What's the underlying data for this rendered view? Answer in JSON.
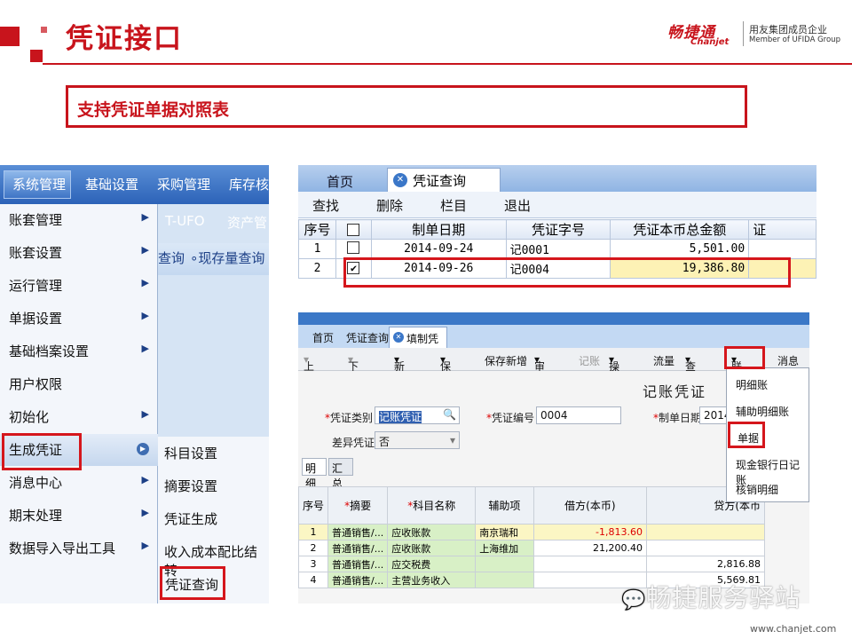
{
  "header": {
    "title": "凭证接口",
    "subtitle": "支持凭证单据对照表"
  },
  "logo": {
    "brand_cn": "畅捷通",
    "brand_en": "Chanjet",
    "group_cn": "用友集团成员企业",
    "group_en": "Member of UFIDA Group"
  },
  "menu": {
    "topbar": [
      "系统管理",
      "基础设置",
      "采购管理",
      "库存核"
    ],
    "right_top": [
      "T-UFO",
      "资产管"
    ],
    "right_strip": "查询",
    "right_strip2": "现存量查询",
    "items": [
      {
        "label": "账套管理",
        "arrow": "▶"
      },
      {
        "label": "账套设置",
        "arrow": "▶"
      },
      {
        "label": "运行管理",
        "arrow": "▶"
      },
      {
        "label": "单据设置",
        "arrow": "▶"
      },
      {
        "label": "基础档案设置",
        "arrow": "▶"
      },
      {
        "label": "用户权限",
        "arrow": ""
      },
      {
        "label": "初始化",
        "arrow": "▶"
      },
      {
        "label": "生成凭证",
        "arrow": "▶"
      },
      {
        "label": "消息中心",
        "arrow": "▶"
      },
      {
        "label": "期末处理",
        "arrow": "▶"
      },
      {
        "label": "数据导入导出工具",
        "arrow": "▶"
      }
    ],
    "submenu": [
      "科目设置",
      "摘要设置",
      "凭证生成",
      "收入成本配比结转",
      "凭证查询"
    ]
  },
  "query": {
    "tabs": [
      "首页",
      "凭证查询"
    ],
    "toolbar": [
      "查找",
      "删除",
      "栏目",
      "退出"
    ],
    "columns": [
      "序号",
      "",
      "制单日期",
      "凭证字号",
      "凭证本币总金额",
      "证"
    ],
    "rows": [
      {
        "no": "1",
        "checked": false,
        "date": "2014-09-24",
        "voucher": "记0001",
        "amount": "5,501.00"
      },
      {
        "no": "2",
        "checked": true,
        "date": "2014-09-26",
        "voucher": "记0004",
        "amount": "19,386.80"
      }
    ]
  },
  "voucher": {
    "tabs": [
      "首页",
      "凭证查询",
      "填制凭证"
    ],
    "toolbar": [
      "上张",
      "下张",
      "新增",
      "保存",
      "保存新增",
      "审核",
      "记账",
      "操作",
      "流量",
      "查找",
      "联查",
      "消息"
    ],
    "title": "记账凭证",
    "type_label": "凭证类别",
    "type_value": "记账凭证",
    "no_label": "凭证编号",
    "no_value": "0004",
    "date_label": "制单日期",
    "date_value": "2014-",
    "diff_label": "差异凭证",
    "diff_value": "否",
    "grid_tabs": [
      "明细",
      "汇总"
    ],
    "columns": [
      "序号",
      "摘要",
      "科目名称",
      "辅助项",
      "借方(本币)",
      "贷方(本币"
    ],
    "rows": [
      {
        "no": "1",
        "summary": "普通销售/...",
        "account": "应收账款",
        "aux": "南京瑞和",
        "debit": "-1,813.60",
        "credit": ""
      },
      {
        "no": "2",
        "summary": "普通销售/...",
        "account": "应收账款",
        "aux": "上海维加",
        "debit": "21,200.40",
        "credit": ""
      },
      {
        "no": "3",
        "summary": "普通销售/...",
        "account": "应交税费",
        "aux": "",
        "debit": "",
        "credit": "2,816.88"
      },
      {
        "no": "4",
        "summary": "普通销售/...",
        "account": "主营业务收入",
        "aux": "",
        "debit": "",
        "credit": "5,569.81"
      }
    ],
    "dropdown": [
      "明细账",
      "辅助明细账",
      "单据",
      "现金银行日记账",
      "核销明细"
    ]
  },
  "watermark": {
    "text": "畅捷服务驿站",
    "url": "www.chanjet.com"
  }
}
